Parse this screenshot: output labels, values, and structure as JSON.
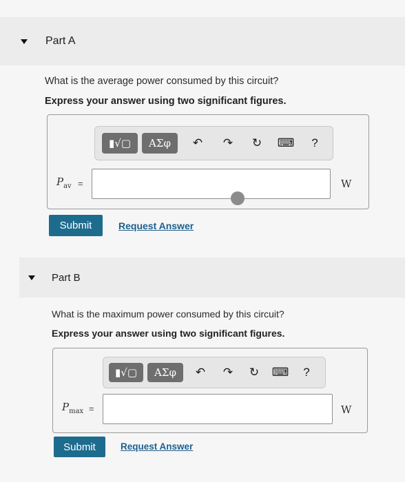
{
  "part_a": {
    "title": "Part A",
    "question": "What is the average power consumed by this circuit?",
    "instruction": "Express your answer using two significant figures.",
    "toolbar": {
      "templates_label": "▮√▢",
      "greek_label": "ΑΣφ",
      "undo_icon": "↶",
      "redo_icon": "↷",
      "reset_icon": "↻",
      "keyboard_icon": "⌨",
      "help_icon": "?"
    },
    "variable": "P",
    "variable_sub": "av",
    "equals": "=",
    "input_value": "",
    "unit": "W",
    "submit_label": "Submit",
    "request_label": "Request Answer"
  },
  "part_b": {
    "title": "Part B",
    "question": "What is the maximum power consumed by this circuit?",
    "instruction": "Express your answer using two significant figures.",
    "toolbar": {
      "templates_label": "▮√▢",
      "greek_label": "ΑΣφ",
      "undo_icon": "↶",
      "redo_icon": "↷",
      "reset_icon": "↻",
      "keyboard_icon": "⌨",
      "help_icon": "?"
    },
    "variable": "P",
    "variable_sub": "max",
    "equals": "=",
    "input_value": "",
    "unit": "W",
    "submit_label": "Submit",
    "request_label": "Request Answer"
  }
}
